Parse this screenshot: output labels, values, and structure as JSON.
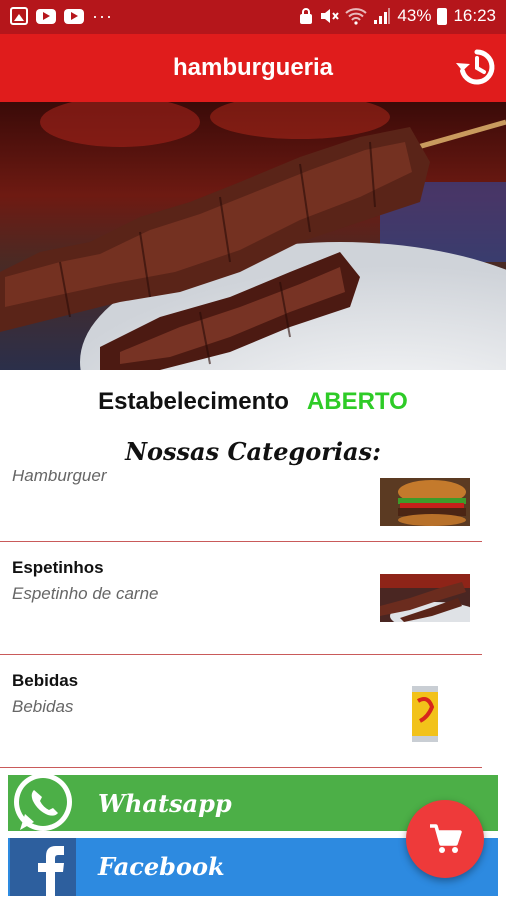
{
  "statusbar": {
    "battery": "43%",
    "time": "16:23",
    "icons": [
      "gallery-icon",
      "youtube-icon",
      "youtube-icon",
      "more-dots-icon",
      "lock-icon",
      "mute-icon",
      "wifi-icon",
      "signal-icon",
      "battery-icon"
    ]
  },
  "appbar": {
    "title": "hamburgueria",
    "history_icon": "history-icon"
  },
  "establishment": {
    "label": "Estabelecimento",
    "status": "ABERTO"
  },
  "categories_title": "Nossas Categorias:",
  "categories": [
    {
      "name": "",
      "description": "Hamburguer",
      "image": "burger"
    },
    {
      "name": "Espetinhos",
      "description": "Espetinho de  carne",
      "image": "skewer"
    },
    {
      "name": "Bebidas",
      "description": "Bebidas",
      "image": "can"
    }
  ],
  "social": {
    "whatsapp": "Whatsapp",
    "facebook": "Facebook"
  },
  "colors": {
    "statusbar": "#b5161b",
    "appbar": "#e01c1c",
    "open": "#2ecb27",
    "whatsapp": "#4caf47",
    "facebook": "#2d8ae0",
    "fab": "#ee3a3a"
  },
  "fab_icon": "cart-icon"
}
